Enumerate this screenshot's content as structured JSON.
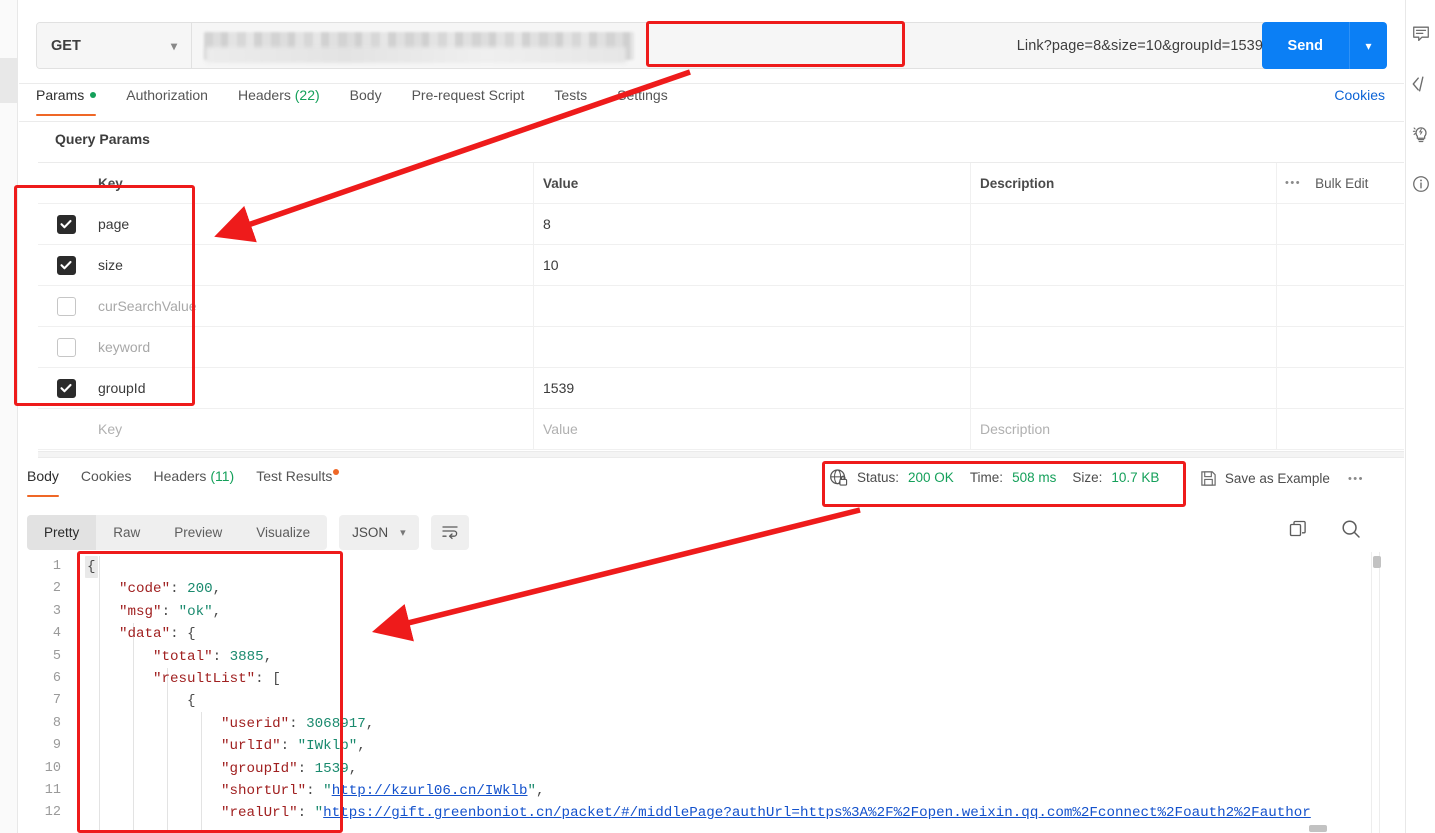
{
  "request": {
    "method": "GET",
    "method_caret": "chevron-down",
    "url_visible_suffix": "Link?page=8&size=10&groupId=1539",
    "send_label": "Send",
    "tabs": [
      {
        "label": "Params",
        "active": true,
        "dot": true
      },
      {
        "label": "Authorization",
        "active": false
      },
      {
        "label": "Headers",
        "count": "(22)",
        "active": false
      },
      {
        "label": "Body",
        "active": false
      },
      {
        "label": "Pre-request Script",
        "active": false
      },
      {
        "label": "Tests",
        "active": false
      },
      {
        "label": "Settings",
        "active": false
      }
    ],
    "cookies_link": "Cookies"
  },
  "query_params": {
    "section_title": "Query Params",
    "columns": [
      "Key",
      "Value",
      "Description"
    ],
    "bulk_edit_label": "Bulk Edit",
    "rows": [
      {
        "enabled": true,
        "key": "page",
        "value": "8",
        "description": "",
        "disabled_style": false
      },
      {
        "enabled": true,
        "key": "size",
        "value": "10",
        "description": "",
        "disabled_style": false
      },
      {
        "enabled": false,
        "key": "curSearchValue",
        "value": "",
        "description": "",
        "disabled_style": true
      },
      {
        "enabled": false,
        "key": "keyword",
        "value": "",
        "description": "",
        "disabled_style": true
      },
      {
        "enabled": true,
        "key": "groupId",
        "value": "1539",
        "description": "",
        "disabled_style": false
      }
    ],
    "new_row_placeholders": {
      "key": "Key",
      "value": "Value",
      "description": "Description"
    }
  },
  "response": {
    "tabs": [
      {
        "label": "Body",
        "active": true
      },
      {
        "label": "Cookies",
        "active": false
      },
      {
        "label": "Headers",
        "count": "(11)",
        "active": false
      },
      {
        "label": "Test Results",
        "active": false,
        "dot": true
      }
    ],
    "status_label": "Status:",
    "status_value": "200 OK",
    "time_label": "Time:",
    "time_value": "508 ms",
    "size_label": "Size:",
    "size_value": "10.7 KB",
    "save_as_example": "Save as Example",
    "view_modes": [
      {
        "label": "Pretty",
        "active": true
      },
      {
        "label": "Raw",
        "active": false
      },
      {
        "label": "Preview",
        "active": false
      },
      {
        "label": "Visualize",
        "active": false
      }
    ],
    "format": "JSON"
  },
  "body_json": {
    "lines": [
      {
        "n": "1",
        "segs": [
          {
            "t": "{",
            "c": "fold"
          }
        ]
      },
      {
        "n": "2",
        "indent": 1,
        "segs": [
          {
            "t": "\"code\"",
            "c": "k"
          },
          {
            "t": ": ",
            "c": "p"
          },
          {
            "t": "200",
            "c": "n"
          },
          {
            "t": ",",
            "c": "p"
          }
        ]
      },
      {
        "n": "3",
        "indent": 1,
        "segs": [
          {
            "t": "\"msg\"",
            "c": "k"
          },
          {
            "t": ": ",
            "c": "p"
          },
          {
            "t": "\"ok\"",
            "c": "s"
          },
          {
            "t": ",",
            "c": "p"
          }
        ]
      },
      {
        "n": "4",
        "indent": 1,
        "segs": [
          {
            "t": "\"data\"",
            "c": "k"
          },
          {
            "t": ": ",
            "c": "p"
          },
          {
            "t": "{",
            "c": "p"
          }
        ]
      },
      {
        "n": "5",
        "indent": 2,
        "segs": [
          {
            "t": "\"total\"",
            "c": "k"
          },
          {
            "t": ": ",
            "c": "p"
          },
          {
            "t": "3885",
            "c": "n"
          },
          {
            "t": ",",
            "c": "p"
          }
        ]
      },
      {
        "n": "6",
        "indent": 2,
        "segs": [
          {
            "t": "\"resultList\"",
            "c": "k"
          },
          {
            "t": ": ",
            "c": "p"
          },
          {
            "t": "[",
            "c": "p"
          }
        ]
      },
      {
        "n": "7",
        "indent": 3,
        "segs": [
          {
            "t": "{",
            "c": "p"
          }
        ]
      },
      {
        "n": "8",
        "indent": 4,
        "segs": [
          {
            "t": "\"userid\"",
            "c": "k"
          },
          {
            "t": ": ",
            "c": "p"
          },
          {
            "t": "3068917",
            "c": "n"
          },
          {
            "t": ",",
            "c": "p"
          }
        ]
      },
      {
        "n": "9",
        "indent": 4,
        "segs": [
          {
            "t": "\"urlId\"",
            "c": "k"
          },
          {
            "t": ": ",
            "c": "p"
          },
          {
            "t": "\"IWklb\"",
            "c": "s"
          },
          {
            "t": ",",
            "c": "p"
          }
        ]
      },
      {
        "n": "10",
        "indent": 4,
        "segs": [
          {
            "t": "\"groupId\"",
            "c": "k"
          },
          {
            "t": ": ",
            "c": "p"
          },
          {
            "t": "1539",
            "c": "n"
          },
          {
            "t": ",",
            "c": "p"
          }
        ]
      },
      {
        "n": "11",
        "indent": 4,
        "segs": [
          {
            "t": "\"shortUrl\"",
            "c": "k"
          },
          {
            "t": ": ",
            "c": "p"
          },
          {
            "t": "\"",
            "c": "s"
          },
          {
            "t": "http://kzurl06.cn/IWklb",
            "c": "lnk"
          },
          {
            "t": "\"",
            "c": "s"
          },
          {
            "t": ",",
            "c": "p"
          }
        ]
      },
      {
        "n": "12",
        "indent": 4,
        "segs": [
          {
            "t": "\"realUrl\"",
            "c": "k"
          },
          {
            "t": ": ",
            "c": "p"
          },
          {
            "t": "\"",
            "c": "s"
          },
          {
            "t": "https://gift.greenboniot.cn/packet/#/middlePage?authUrl=https%3A%2F%2Fopen.weixin.qq.com%2Fconnect%2Foauth2%2Fauthor",
            "c": "lnk"
          }
        ]
      }
    ]
  },
  "icons": {
    "right_rail": [
      "comment-icon",
      "code-icon",
      "lightbulb-icon",
      "info-icon"
    ],
    "response_tools": [
      "copy-icon",
      "search-icon"
    ]
  },
  "colors": {
    "accent_orange": "#ef6726",
    "send_blue": "#0b7ff5",
    "link_blue": "#0b63d6",
    "status_green": "#14a05a",
    "annotation_red": "#ee1b1b"
  }
}
